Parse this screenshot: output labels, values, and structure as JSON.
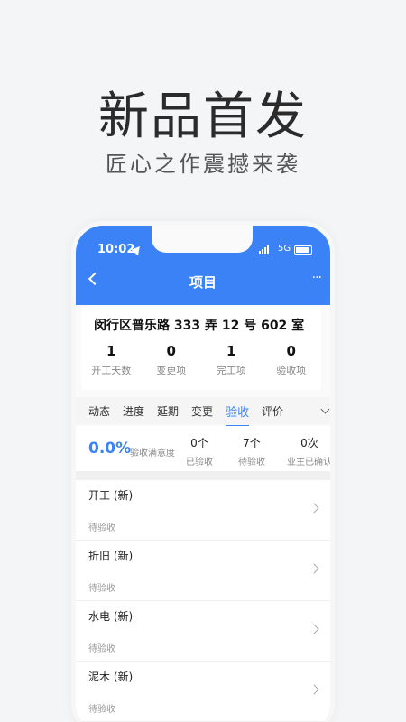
{
  "hero": {
    "title": "新品首发",
    "subtitle": "匠心之作震撼来袭"
  },
  "status_bar": {
    "time": "10:02",
    "network": "5G"
  },
  "header": {
    "title": "项目",
    "more": "···"
  },
  "project": {
    "address": "闵行区普乐路 333 弄 12 号 602 室",
    "stats": [
      {
        "value": "1",
        "label": "开工天数"
      },
      {
        "value": "0",
        "label": "变更项"
      },
      {
        "value": "1",
        "label": "完工项"
      },
      {
        "value": "0",
        "label": "验收项"
      }
    ]
  },
  "tabs": [
    "动态",
    "进度",
    "延期",
    "变更",
    "验收",
    "评价"
  ],
  "active_tab": "验收",
  "summary": {
    "rate": "0.0%",
    "rate_label": "验收满意度",
    "items": [
      {
        "value": "0个",
        "label": "已验收"
      },
      {
        "value": "7个",
        "label": "待验收"
      },
      {
        "value": "0次",
        "label": "业主已确认"
      }
    ]
  },
  "items": [
    {
      "title": "开工 (新)",
      "status": "待验收"
    },
    {
      "title": "折旧 (新)",
      "status": "待验收"
    },
    {
      "title": "水电 (新)",
      "status": "待验收"
    },
    {
      "title": "泥木 (新)",
      "status": "待验收"
    }
  ],
  "colors": {
    "accent": "#3b82f6",
    "background": "#f4f5f7"
  }
}
